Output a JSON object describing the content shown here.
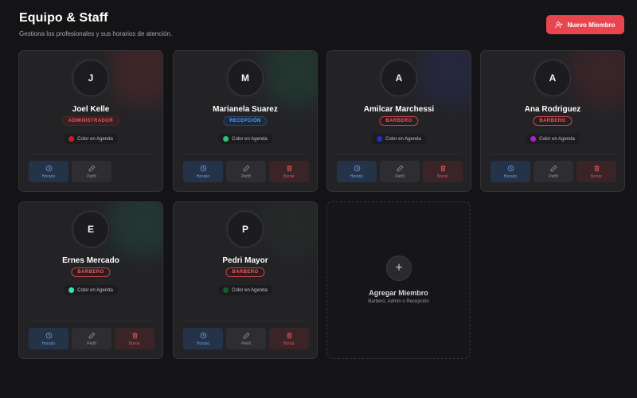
{
  "header": {
    "title": "Equipo & Staff",
    "subtitle": "Gestiona los profesionales y sus horarios de atención.",
    "new_button_label": "Nuevo Miembro"
  },
  "labels": {
    "agenda_color": "Color en Agenda",
    "horario": "Horario",
    "perfil": "Perfil",
    "borrar": "Borrar"
  },
  "members": [
    {
      "initial": "J",
      "name": "Joel Kelle",
      "role": "ADMINISTRADOR",
      "role_kind": "admin",
      "agenda_color": "#c81e1e",
      "glow_color": "#c83a3a",
      "can_delete": false
    },
    {
      "initial": "M",
      "name": "Marianela Suarez",
      "role": "RECEPCIÓN",
      "role_kind": "recep",
      "agenda_color": "#22c77a",
      "glow_color": "#2a9a68",
      "can_delete": true
    },
    {
      "initial": "A",
      "name": "Amilcar Marchessi",
      "role": "BARBERO",
      "role_kind": "barber",
      "agenda_color": "#1d2fc9",
      "glow_color": "#3b44b8",
      "can_delete": true
    },
    {
      "initial": "A",
      "name": "Ana Rodriguez",
      "role": "BARBERO",
      "role_kind": "barber",
      "agenda_color": "#b51ad6",
      "glow_color": "#a8323a",
      "can_delete": true
    },
    {
      "initial": "E",
      "name": "Ernes Mercado",
      "role": "BARBERO",
      "role_kind": "barber",
      "agenda_color": "#3fe0b0",
      "glow_color": "#2a9a78",
      "can_delete": true
    },
    {
      "initial": "P",
      "name": "Pedri Mayor",
      "role": "BARBERO",
      "role_kind": "barber",
      "agenda_color": "#0f5f2a",
      "glow_color": "#2f4a36",
      "can_delete": true
    }
  ],
  "add_member": {
    "title": "Agregar Miembro",
    "subtitle": "Barbero, Admin o Recepción"
  }
}
